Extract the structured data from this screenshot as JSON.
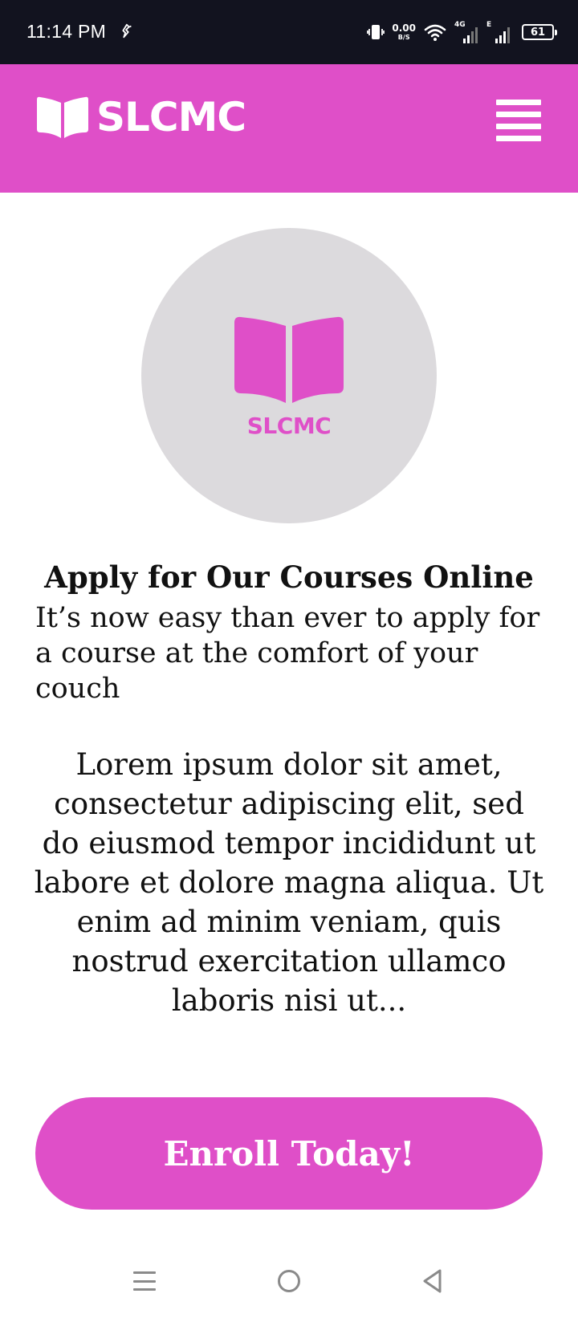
{
  "status_bar": {
    "time": "11:14 PM",
    "net_speed_value": "0.00",
    "net_speed_unit": "B/S",
    "sim1_label": "4G",
    "sim2_label": "E",
    "battery_level": "61"
  },
  "header": {
    "brand_name": "SLCMC",
    "background_color": "#df4fc8"
  },
  "logo": {
    "text": "SLCMC",
    "circle_color": "#dcdadd",
    "accent_color": "#df4fc8"
  },
  "main": {
    "headline": "Apply for Our Courses Online",
    "subtitle": "It’s now easy than ever to apply for a course at the comfort of your couch",
    "body": "Lorem ipsum dolor sit amet, consectetur adipiscing elit, sed do eiusmod tempor incididunt ut labore et dolore magna aliqua. Ut enim ad minim veniam, quis nostrud exercitation ullamco laboris nisi ut...",
    "cta_label": "Enroll Today!"
  },
  "icons": {
    "brand": "book-open-icon",
    "menu": "hamburger-menu-icon",
    "nav_recents": "recents-icon",
    "nav_home": "home-circle-icon",
    "nav_back": "back-triangle-icon"
  }
}
